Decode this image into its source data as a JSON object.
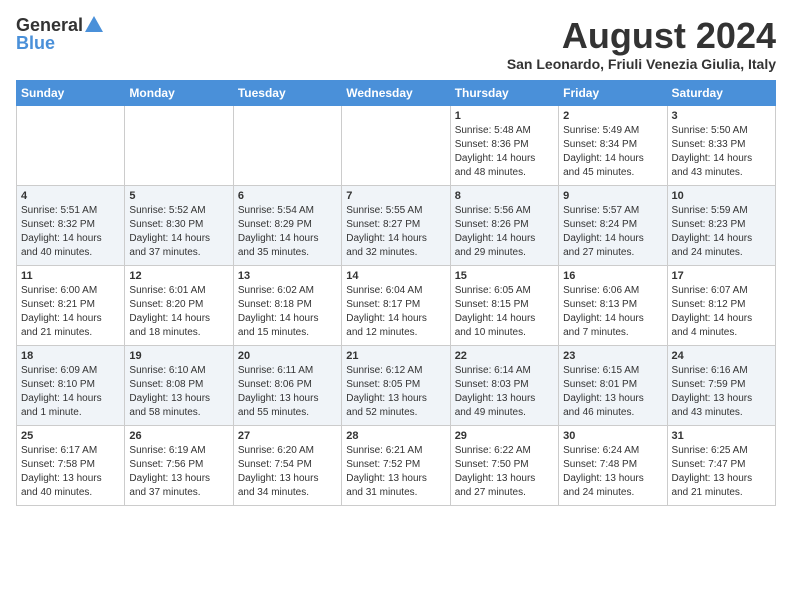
{
  "header": {
    "logo_general": "General",
    "logo_blue": "Blue",
    "month_title": "August 2024",
    "location": "San Leonardo, Friuli Venezia Giulia, Italy"
  },
  "weekdays": [
    "Sunday",
    "Monday",
    "Tuesday",
    "Wednesday",
    "Thursday",
    "Friday",
    "Saturday"
  ],
  "weeks": [
    [
      {
        "day": "",
        "text": ""
      },
      {
        "day": "",
        "text": ""
      },
      {
        "day": "",
        "text": ""
      },
      {
        "day": "",
        "text": ""
      },
      {
        "day": "1",
        "text": "Sunrise: 5:48 AM\nSunset: 8:36 PM\nDaylight: 14 hours\nand 48 minutes."
      },
      {
        "day": "2",
        "text": "Sunrise: 5:49 AM\nSunset: 8:34 PM\nDaylight: 14 hours\nand 45 minutes."
      },
      {
        "day": "3",
        "text": "Sunrise: 5:50 AM\nSunset: 8:33 PM\nDaylight: 14 hours\nand 43 minutes."
      }
    ],
    [
      {
        "day": "4",
        "text": "Sunrise: 5:51 AM\nSunset: 8:32 PM\nDaylight: 14 hours\nand 40 minutes."
      },
      {
        "day": "5",
        "text": "Sunrise: 5:52 AM\nSunset: 8:30 PM\nDaylight: 14 hours\nand 37 minutes."
      },
      {
        "day": "6",
        "text": "Sunrise: 5:54 AM\nSunset: 8:29 PM\nDaylight: 14 hours\nand 35 minutes."
      },
      {
        "day": "7",
        "text": "Sunrise: 5:55 AM\nSunset: 8:27 PM\nDaylight: 14 hours\nand 32 minutes."
      },
      {
        "day": "8",
        "text": "Sunrise: 5:56 AM\nSunset: 8:26 PM\nDaylight: 14 hours\nand 29 minutes."
      },
      {
        "day": "9",
        "text": "Sunrise: 5:57 AM\nSunset: 8:24 PM\nDaylight: 14 hours\nand 27 minutes."
      },
      {
        "day": "10",
        "text": "Sunrise: 5:59 AM\nSunset: 8:23 PM\nDaylight: 14 hours\nand 24 minutes."
      }
    ],
    [
      {
        "day": "11",
        "text": "Sunrise: 6:00 AM\nSunset: 8:21 PM\nDaylight: 14 hours\nand 21 minutes."
      },
      {
        "day": "12",
        "text": "Sunrise: 6:01 AM\nSunset: 8:20 PM\nDaylight: 14 hours\nand 18 minutes."
      },
      {
        "day": "13",
        "text": "Sunrise: 6:02 AM\nSunset: 8:18 PM\nDaylight: 14 hours\nand 15 minutes."
      },
      {
        "day": "14",
        "text": "Sunrise: 6:04 AM\nSunset: 8:17 PM\nDaylight: 14 hours\nand 12 minutes."
      },
      {
        "day": "15",
        "text": "Sunrise: 6:05 AM\nSunset: 8:15 PM\nDaylight: 14 hours\nand 10 minutes."
      },
      {
        "day": "16",
        "text": "Sunrise: 6:06 AM\nSunset: 8:13 PM\nDaylight: 14 hours\nand 7 minutes."
      },
      {
        "day": "17",
        "text": "Sunrise: 6:07 AM\nSunset: 8:12 PM\nDaylight: 14 hours\nand 4 minutes."
      }
    ],
    [
      {
        "day": "18",
        "text": "Sunrise: 6:09 AM\nSunset: 8:10 PM\nDaylight: 14 hours\nand 1 minute."
      },
      {
        "day": "19",
        "text": "Sunrise: 6:10 AM\nSunset: 8:08 PM\nDaylight: 13 hours\nand 58 minutes."
      },
      {
        "day": "20",
        "text": "Sunrise: 6:11 AM\nSunset: 8:06 PM\nDaylight: 13 hours\nand 55 minutes."
      },
      {
        "day": "21",
        "text": "Sunrise: 6:12 AM\nSunset: 8:05 PM\nDaylight: 13 hours\nand 52 minutes."
      },
      {
        "day": "22",
        "text": "Sunrise: 6:14 AM\nSunset: 8:03 PM\nDaylight: 13 hours\nand 49 minutes."
      },
      {
        "day": "23",
        "text": "Sunrise: 6:15 AM\nSunset: 8:01 PM\nDaylight: 13 hours\nand 46 minutes."
      },
      {
        "day": "24",
        "text": "Sunrise: 6:16 AM\nSunset: 7:59 PM\nDaylight: 13 hours\nand 43 minutes."
      }
    ],
    [
      {
        "day": "25",
        "text": "Sunrise: 6:17 AM\nSunset: 7:58 PM\nDaylight: 13 hours\nand 40 minutes."
      },
      {
        "day": "26",
        "text": "Sunrise: 6:19 AM\nSunset: 7:56 PM\nDaylight: 13 hours\nand 37 minutes."
      },
      {
        "day": "27",
        "text": "Sunrise: 6:20 AM\nSunset: 7:54 PM\nDaylight: 13 hours\nand 34 minutes."
      },
      {
        "day": "28",
        "text": "Sunrise: 6:21 AM\nSunset: 7:52 PM\nDaylight: 13 hours\nand 31 minutes."
      },
      {
        "day": "29",
        "text": "Sunrise: 6:22 AM\nSunset: 7:50 PM\nDaylight: 13 hours\nand 27 minutes."
      },
      {
        "day": "30",
        "text": "Sunrise: 6:24 AM\nSunset: 7:48 PM\nDaylight: 13 hours\nand 24 minutes."
      },
      {
        "day": "31",
        "text": "Sunrise: 6:25 AM\nSunset: 7:47 PM\nDaylight: 13 hours\nand 21 minutes."
      }
    ]
  ]
}
